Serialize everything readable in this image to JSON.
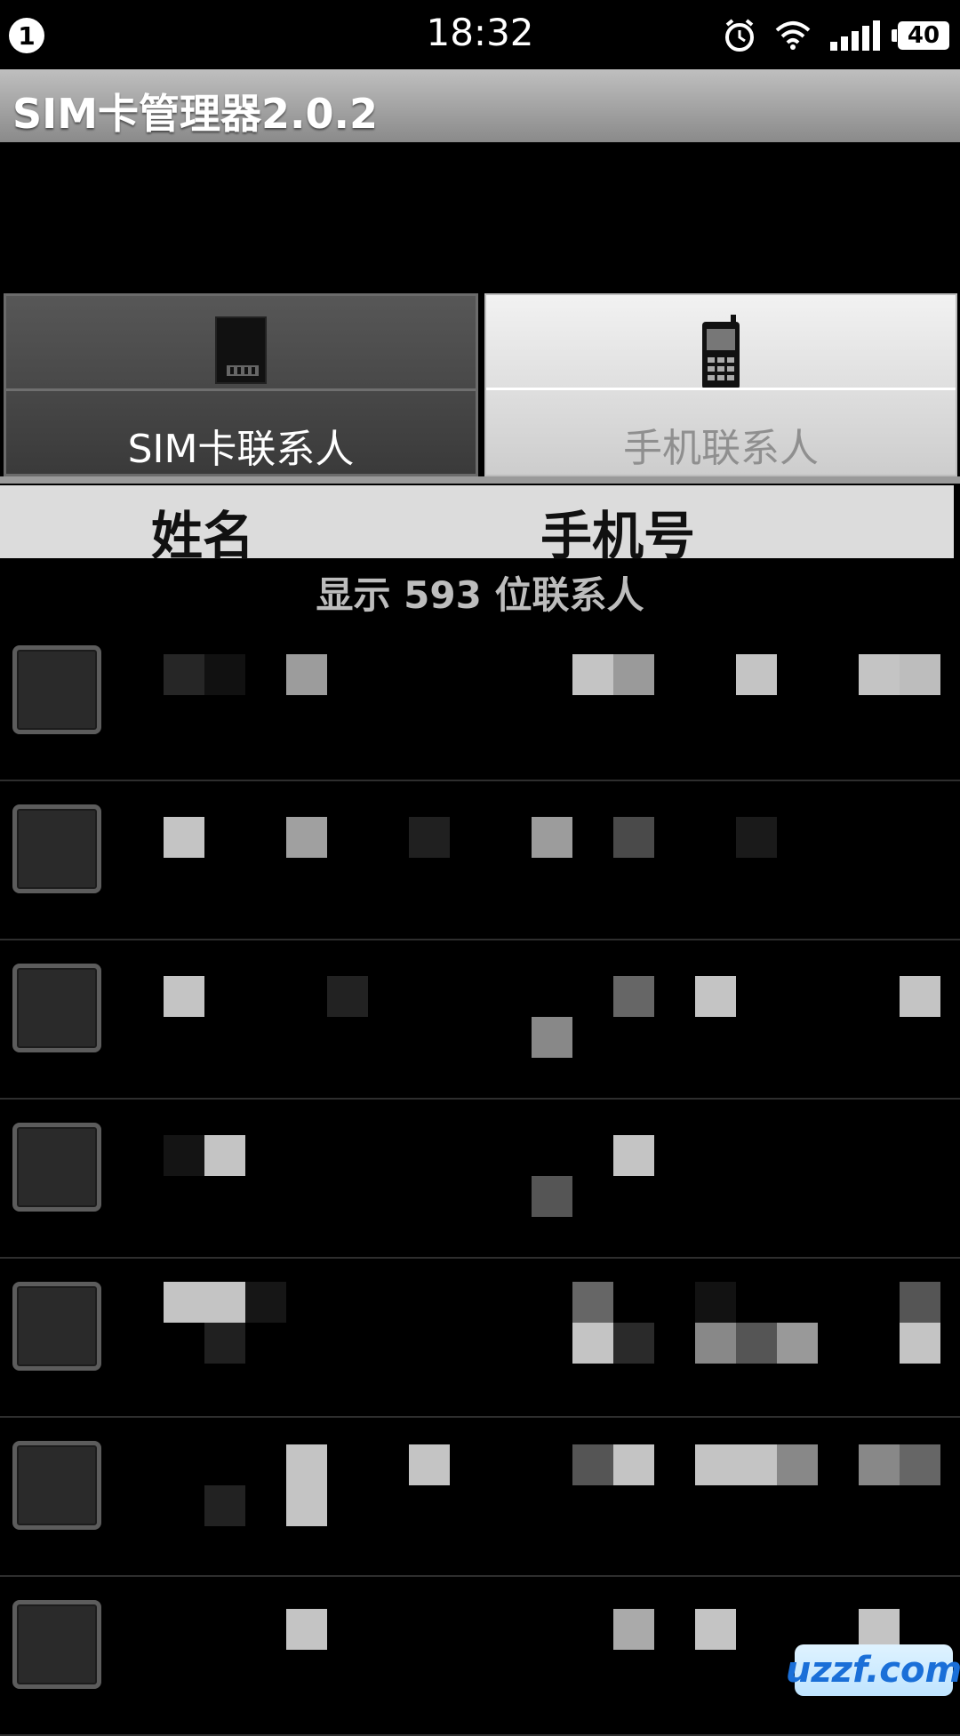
{
  "status_bar": {
    "notification_count": "1",
    "time": "18:32",
    "battery": "40",
    "icons": [
      "alarm-icon",
      "wifi-icon",
      "signal-icon",
      "battery-icon"
    ]
  },
  "app": {
    "title": "SIM卡管理器2.0.2"
  },
  "tabs": [
    {
      "label": "SIM卡联系人",
      "icon": "sim-card-icon",
      "selected": true
    },
    {
      "label": "手机联系人",
      "icon": "mobile-phone-icon",
      "selected": false
    }
  ],
  "columns": {
    "name": "姓名",
    "phone": "手机号"
  },
  "contact_count_text": "显示 593 位联系人",
  "list": {
    "rows": 7
  },
  "watermark": {
    "text": "uzzf.com"
  }
}
